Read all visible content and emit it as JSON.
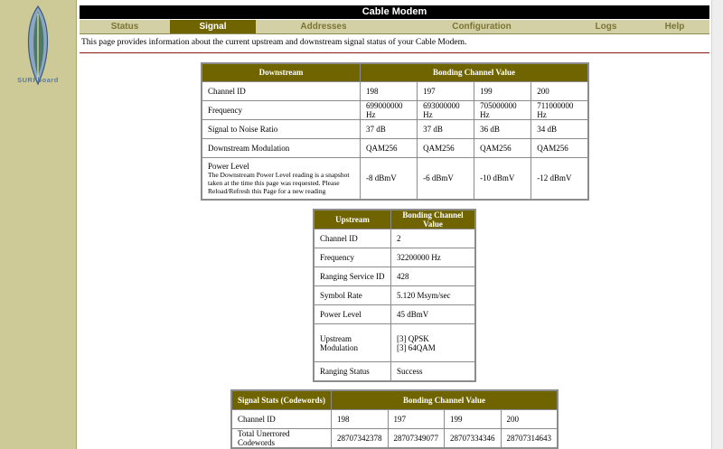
{
  "sidebar": {
    "logo_text": "SURFboard"
  },
  "header": {
    "title": "Cable Modem"
  },
  "nav": {
    "tabs": [
      {
        "label": "Status",
        "active": false
      },
      {
        "label": "Signal",
        "active": true
      },
      {
        "label": "Addresses",
        "active": false
      },
      {
        "label": "Configuration",
        "active": false
      },
      {
        "label": "Logs",
        "active": false
      },
      {
        "label": "Help",
        "active": false
      }
    ]
  },
  "intro": "This page provides information about the current upstream and downstream signal status of your Cable Modem.",
  "downstream": {
    "header": "Downstream",
    "value_header": "Bonding Channel Value",
    "rows": [
      {
        "label": "Channel ID",
        "values": [
          "198",
          "197",
          "199",
          "200"
        ]
      },
      {
        "label": "Frequency",
        "values": [
          "699000000 Hz",
          "693000000 Hz",
          "705000000 Hz",
          "711000000 Hz"
        ]
      },
      {
        "label": "Signal to Noise Ratio",
        "values": [
          "37 dB",
          "37 dB",
          "36 dB",
          "34 dB"
        ]
      },
      {
        "label": "Downstream Modulation",
        "values": [
          "QAM256",
          "QAM256",
          "QAM256",
          "QAM256"
        ]
      }
    ],
    "power": {
      "label": "Power Level",
      "note": "The Downstream Power Level reading is a snapshot taken at the time this page was requested. Please Reload/Refresh this Page for a new reading",
      "values": [
        "-8 dBmV",
        "-6 dBmV",
        "-10 dBmV",
        "-12 dBmV"
      ]
    }
  },
  "upstream": {
    "header": "Upstream",
    "value_header": "Bonding Channel Value",
    "rows": [
      {
        "label": "Channel ID",
        "value": "2"
      },
      {
        "label": "Frequency",
        "value": "32200000 Hz"
      },
      {
        "label": "Ranging Service ID",
        "value": "428"
      },
      {
        "label": "Symbol Rate",
        "value": "5.120 Msym/sec"
      },
      {
        "label": "Power Level",
        "value": "45 dBmV"
      }
    ],
    "modulation": {
      "label": "Upstream Modulation",
      "values": [
        "[3] QPSK",
        "[3] 64QAM"
      ]
    },
    "status": {
      "label": "Ranging Status",
      "value": "Success"
    }
  },
  "stats": {
    "header": "Signal Stats (Codewords)",
    "value_header": "Bonding Channel Value",
    "rows": [
      {
        "label": "Channel ID",
        "values": [
          "198",
          "197",
          "199",
          "200"
        ]
      },
      {
        "label": "Total Unerrored Codewords",
        "values": [
          "28707342378",
          "28707349077",
          "28707334346",
          "28707314643"
        ]
      }
    ]
  },
  "colors": {
    "accent": "#6f6400",
    "sidebar": "#cdca98",
    "nav": "#d3d0a5",
    "divider": "#8b1a1a"
  }
}
